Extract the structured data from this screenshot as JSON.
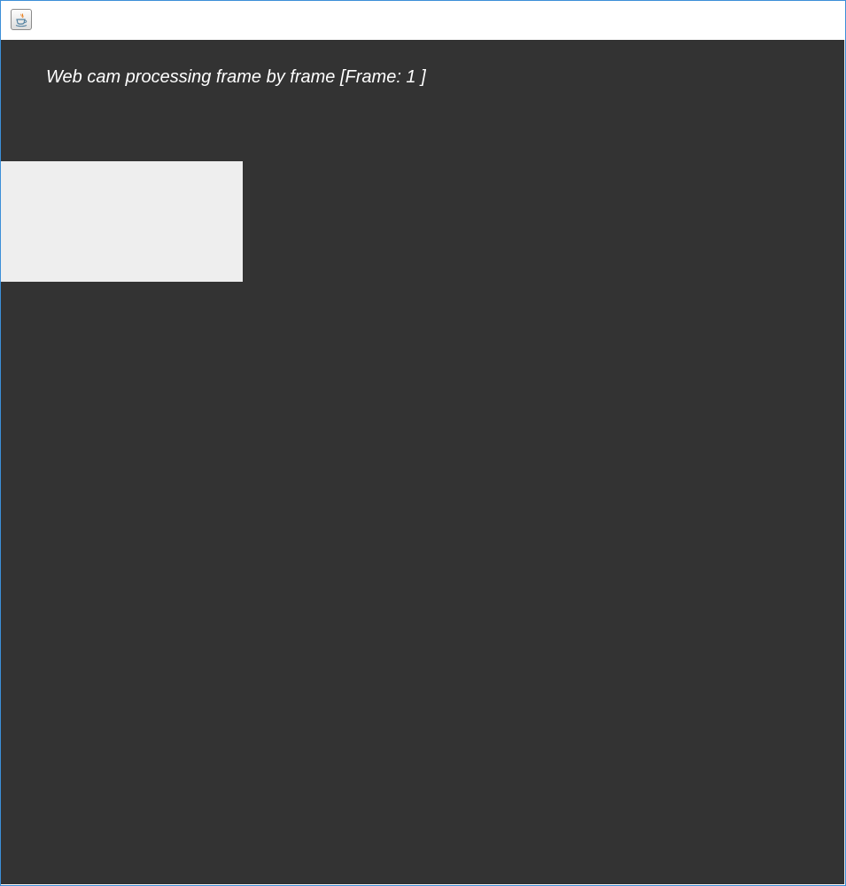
{
  "window": {
    "title": "",
    "icon": "java-coffee-cup-icon"
  },
  "panel": {
    "background": "#333333",
    "caption": "Web cam processing frame by frame [Frame: 1 ]",
    "caption_color": "#ffffff"
  },
  "video": {
    "placeholder_color": "#eeeeee"
  }
}
